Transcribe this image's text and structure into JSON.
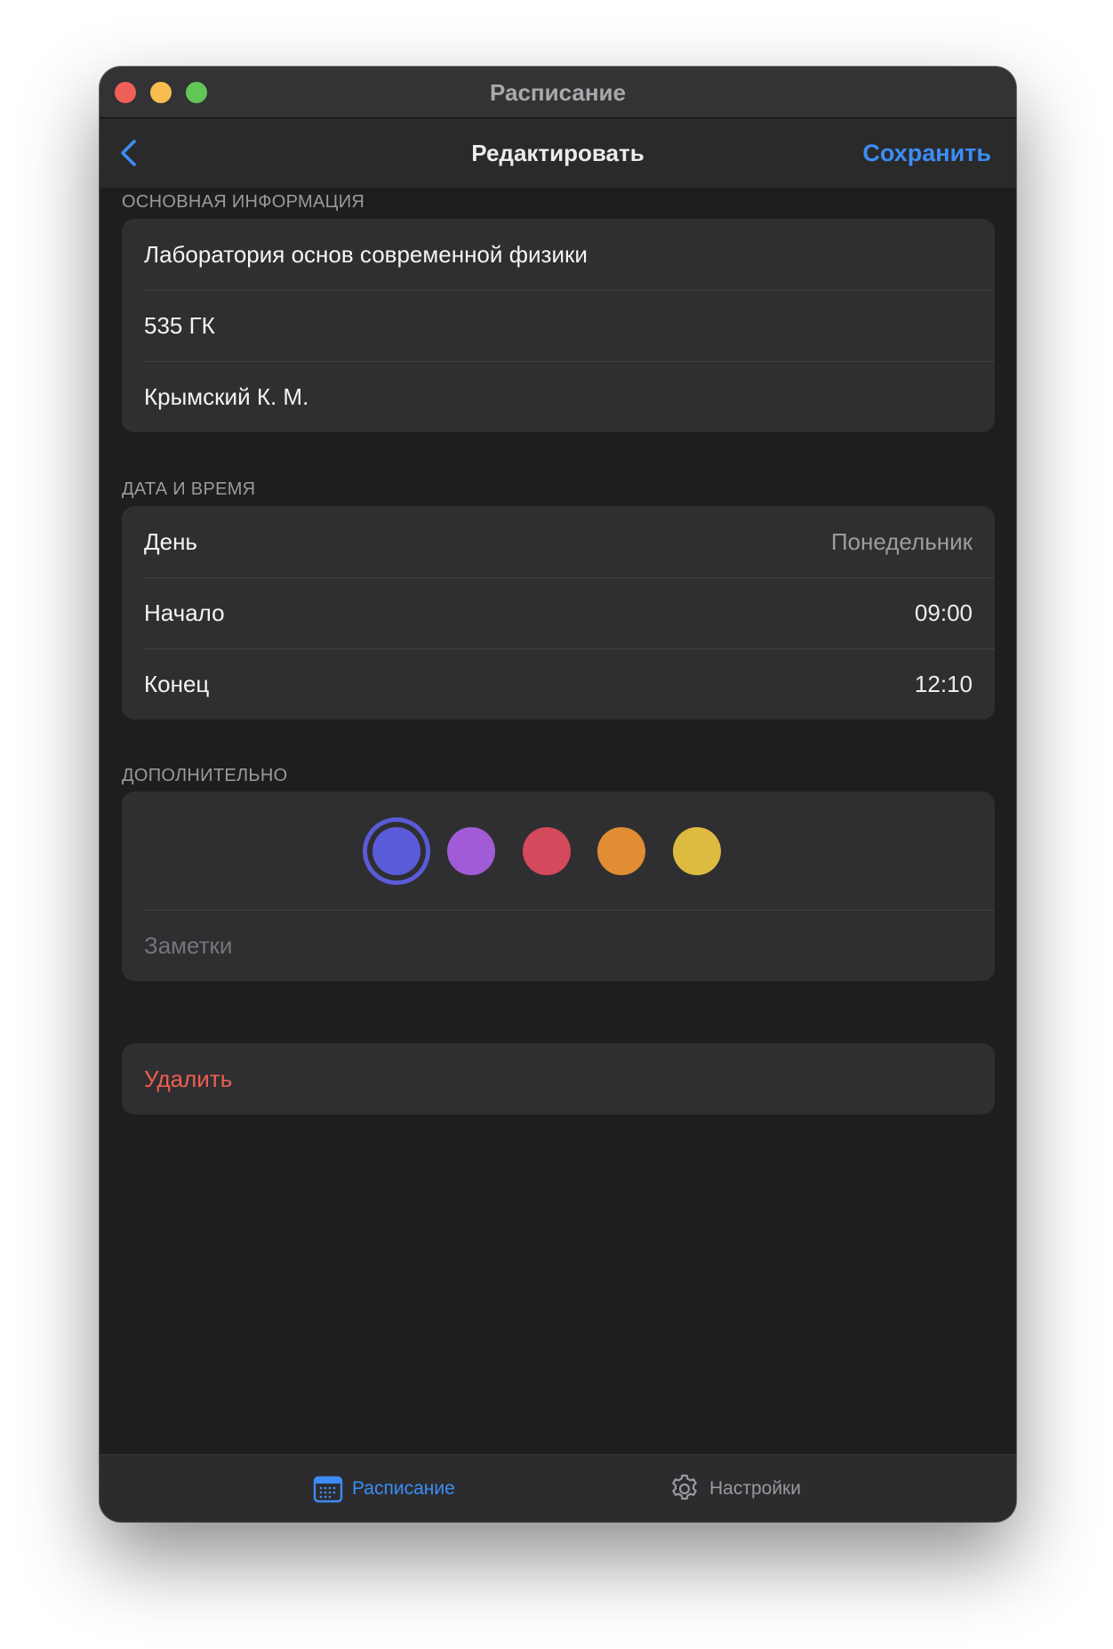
{
  "window": {
    "title": "Расписание"
  },
  "navbar": {
    "title": "Редактировать",
    "save_label": "Сохранить",
    "accent_color": "#3c8df6"
  },
  "basic_info": {
    "header": "ОСНОВНАЯ ИНФОРМАЦИЯ",
    "subject": "Лаборатория основ современной физики",
    "room": "535 ГК",
    "teacher": "Крымский К. М."
  },
  "date_time": {
    "header": "ДАТА И ВРЕМЯ",
    "rows": [
      {
        "label": "День",
        "value": "Понедельник"
      },
      {
        "label": "Начало",
        "value": "09:00"
      },
      {
        "label": "Конец",
        "value": "12:10"
      }
    ]
  },
  "additional": {
    "header": "ДОПОЛНИТЕЛЬНО",
    "colors": [
      {
        "name": "indigo",
        "hex": "#5a5bd9",
        "selected": true
      },
      {
        "name": "purple",
        "hex": "#a15bd6",
        "selected": false
      },
      {
        "name": "red",
        "hex": "#d4495c",
        "selected": false
      },
      {
        "name": "orange",
        "hex": "#e08d33",
        "selected": false
      },
      {
        "name": "yellow",
        "hex": "#ddbb40",
        "selected": false
      }
    ],
    "notes_placeholder": "Заметки",
    "notes_value": ""
  },
  "delete": {
    "label": "Удалить",
    "color": "#ec5f4f"
  },
  "tabbar": {
    "tabs": [
      {
        "label": "Расписание",
        "icon": "calendar-icon",
        "active": true
      },
      {
        "label": "Настройки",
        "icon": "gear-icon",
        "active": false
      }
    ]
  }
}
